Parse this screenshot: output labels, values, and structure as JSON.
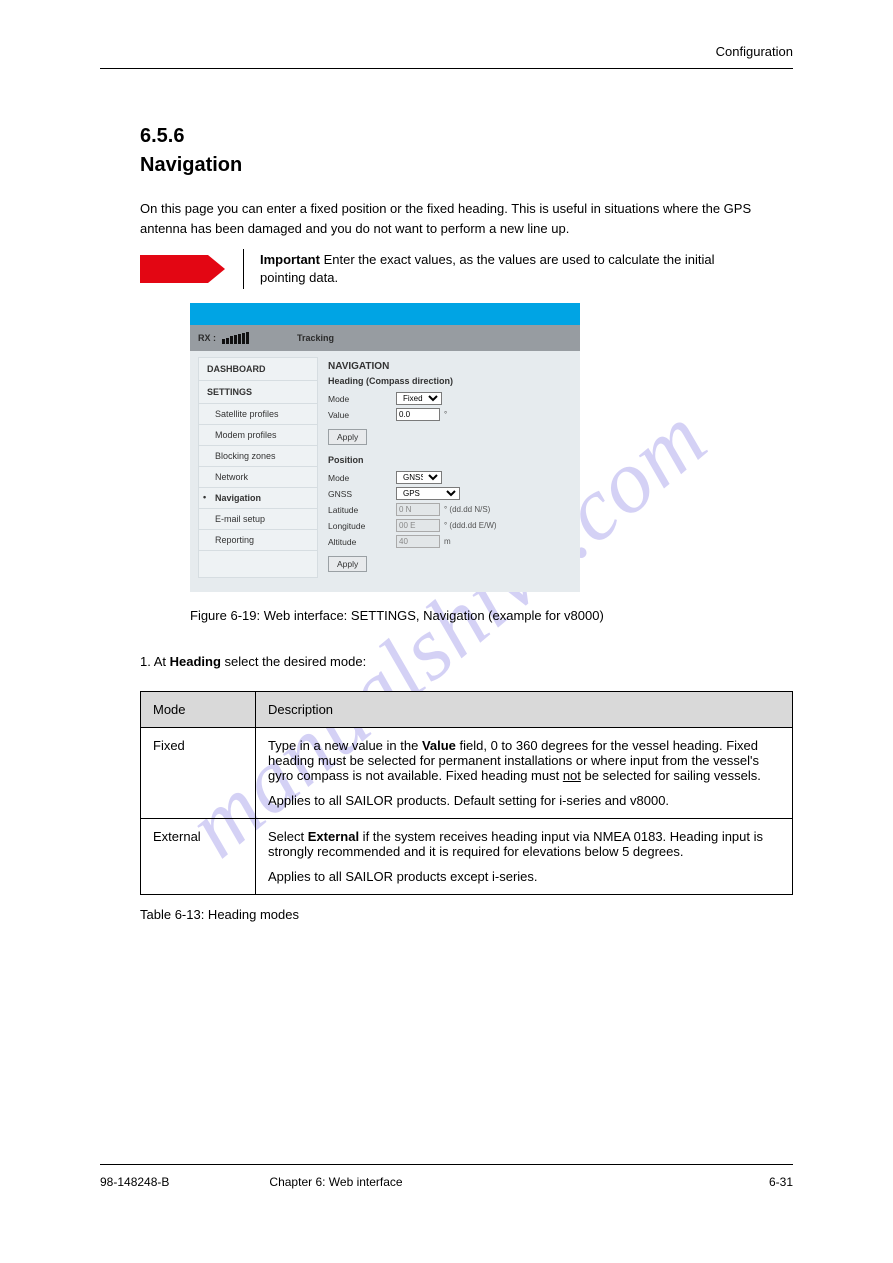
{
  "running_head": "Configuration",
  "section": {
    "num": "6.5.6",
    "title": "Navigation"
  },
  "intro": "On this page you can enter a fixed position or the fixed heading. This is useful in situations where the GPS antenna has been damaged and you do not want to perform a new line up.",
  "important": {
    "bold": "Important",
    "text": "Enter the exact values, as the values are used to calculate the initial pointing data."
  },
  "screenshot": {
    "rx_label": "RX :",
    "status_tracking": "Tracking",
    "sidebar": {
      "dashboard": "DASHBOARD",
      "settings": "SETTINGS",
      "items": [
        {
          "label": "Satellite profiles",
          "active": false
        },
        {
          "label": "Modem profiles",
          "active": false
        },
        {
          "label": "Blocking zones",
          "active": false
        },
        {
          "label": "Network",
          "active": false
        },
        {
          "label": "Navigation",
          "active": true,
          "bold": true
        },
        {
          "label": "E-mail setup",
          "active": false
        },
        {
          "label": "Reporting",
          "active": false
        }
      ]
    },
    "main": {
      "title": "NAVIGATION",
      "heading_section": "Heading (Compass direction)",
      "mode_label": "Mode",
      "heading_mode_value": "Fixed",
      "value_label": "Value",
      "value_value": "0.0",
      "value_unit": "°",
      "apply_label": "Apply",
      "position_section": "Position",
      "pos_mode_value": "GNSS",
      "gnss_label": "GNSS",
      "gnss_value": "GPS",
      "lat_label": "Latitude",
      "lat_value": "0 N",
      "lat_hint": "° (dd.dd N/S)",
      "lon_label": "Longitude",
      "lon_value": "00 E",
      "lon_hint": "° (ddd.dd E/W)",
      "alt_label": "Altitude",
      "alt_value": "40",
      "alt_unit": "m"
    }
  },
  "figcap": {
    "label": "Figure 6-19:",
    "text": "Web interface: SETTINGS, Navigation (example for v8000)"
  },
  "step1_lead": "1. At",
  "step1_bold": " Heading",
  "step1_rest": " select the desired mode:",
  "table": {
    "mode_hdr": "Mode",
    "desc_hdr": "Description",
    "fixed": "Fixed",
    "fixed_desc_lead": "Type in a new value in the ",
    "fixed_desc_bold": "Value",
    "fixed_desc_rest": " field, 0 to 360 degrees for the vessel heading. Fixed heading must be selected for permanent installations or where input from the vessel's gyro compass is not available. Fixed heading must ",
    "fixed_desc_underline": "not",
    "fixed_desc_tail": " be selected for sailing vessels.",
    "fixed_applies": "Applies to all SAILOR products. Default setting for i-series and v8000.",
    "external": "External",
    "external_desc_lead": "Select ",
    "external_desc_bold": "External",
    "external_desc_rest": " if the system receives heading input via NMEA 0183. Heading input is strongly recommended and it is required for elevations below 5 degrees.",
    "external_applies": "Applies to all SAILOR products except i-series."
  },
  "table_caption": "Table 6-13:  Heading modes",
  "footer": {
    "left": "98-148248-B",
    "chapter": "Chapter 6: Web interface",
    "right": "6-31"
  },
  "watermark": "manualshive.com"
}
